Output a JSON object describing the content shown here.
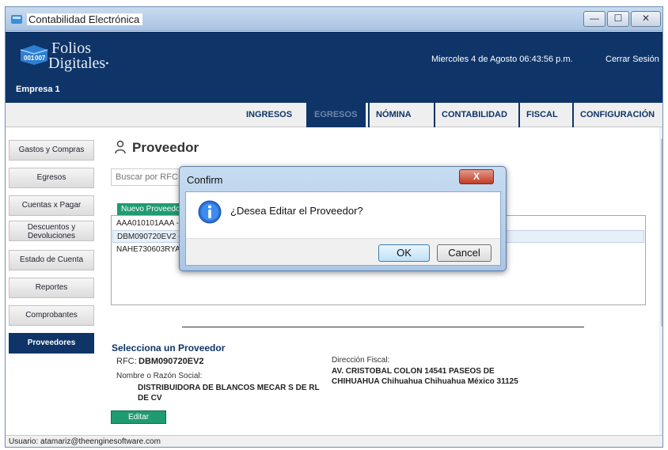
{
  "window": {
    "title": "Contabilidad Electrónica",
    "minimize_glyph": "—",
    "maximize_glyph": "☐",
    "close_glyph": "✕"
  },
  "header": {
    "logo_line1": "Folios",
    "logo_line2": "Digitales",
    "logo_mark": "•",
    "empresa": "Empresa 1",
    "datetime": "Miercoles 4 de Agosto 06:43:56 p.m.",
    "logout": "Cerrar Sesión"
  },
  "nav": {
    "items": [
      {
        "label": "INGRESOS"
      },
      {
        "label": "EGRESOS"
      },
      {
        "label": "NÓMINA"
      },
      {
        "label": "CONTABILIDAD"
      },
      {
        "label": "FISCAL"
      },
      {
        "label": "CONFIGURACIÓN"
      }
    ],
    "active": "EGRESOS"
  },
  "sidebar": {
    "items": [
      {
        "label": "Gastos y Compras"
      },
      {
        "label": "Egresos"
      },
      {
        "label": "Cuentas x Pagar"
      },
      {
        "label_line1": "Descuentos y",
        "label_line2": "Devoluciones"
      },
      {
        "label": "Estado de Cuenta"
      },
      {
        "label": "Reportes"
      },
      {
        "label": "Comprobantes"
      },
      {
        "label": "Proveedores"
      }
    ],
    "active": "Proveedores"
  },
  "main": {
    "title": "Proveedor",
    "search_placeholder": "Buscar por RFC",
    "new_button": "Nuevo Proveedo",
    "list": [
      {
        "text": "AAA010101AAA -"
      },
      {
        "text": "DBM090720EV2 -"
      },
      {
        "text": "NAHE730603RYA"
      }
    ],
    "selected_title": "Selecciona un Proveedor",
    "rfc_label": "RFC:",
    "rfc_value": "DBM090720EV2",
    "nombre_label": "Nombre o Razón Social:",
    "nombre_value": "DISTRIBUIDORA DE BLANCOS MECAR S DE RL DE CV",
    "direccion_label": "Dirección Fiscal:",
    "direccion_value": "AV. CRISTOBAL COLON 14541 PASEOS DE CHIHUAHUA Chihuahua Chihuahua México 31125",
    "edit_button": "Editar"
  },
  "status": {
    "user": "Usuario: atamariz@theenginesoftware.com"
  },
  "dialog": {
    "title": "Confirm",
    "message": "¿Desea Editar el Proveedor?",
    "ok": "OK",
    "cancel": "Cancel",
    "close_glyph": "X"
  },
  "colors": {
    "brand": "#0e3468",
    "accent_green": "#1f9b71",
    "dialog_frame": "#aac6e6"
  }
}
